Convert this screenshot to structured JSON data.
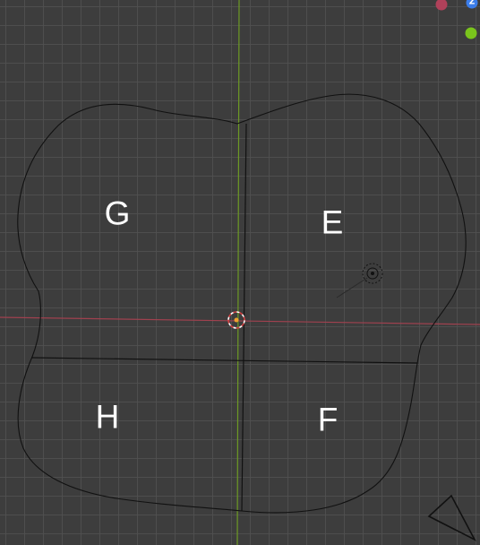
{
  "viewport": {
    "labels": {
      "g": "G",
      "e": "E",
      "h": "H",
      "f": "F"
    },
    "gizmo": {
      "z_label": "Z",
      "x_neg_color": "#b0415a",
      "z_color": "#3b7dea",
      "y_color": "#7ac41c"
    },
    "colors": {
      "background": "#3d3d3d",
      "grid": "#505050",
      "x_axis": "#a0414f",
      "y_axis": "#6d9a24",
      "outline": "#111111",
      "cursor": "#ffffff",
      "origin": "#f0a030"
    }
  }
}
